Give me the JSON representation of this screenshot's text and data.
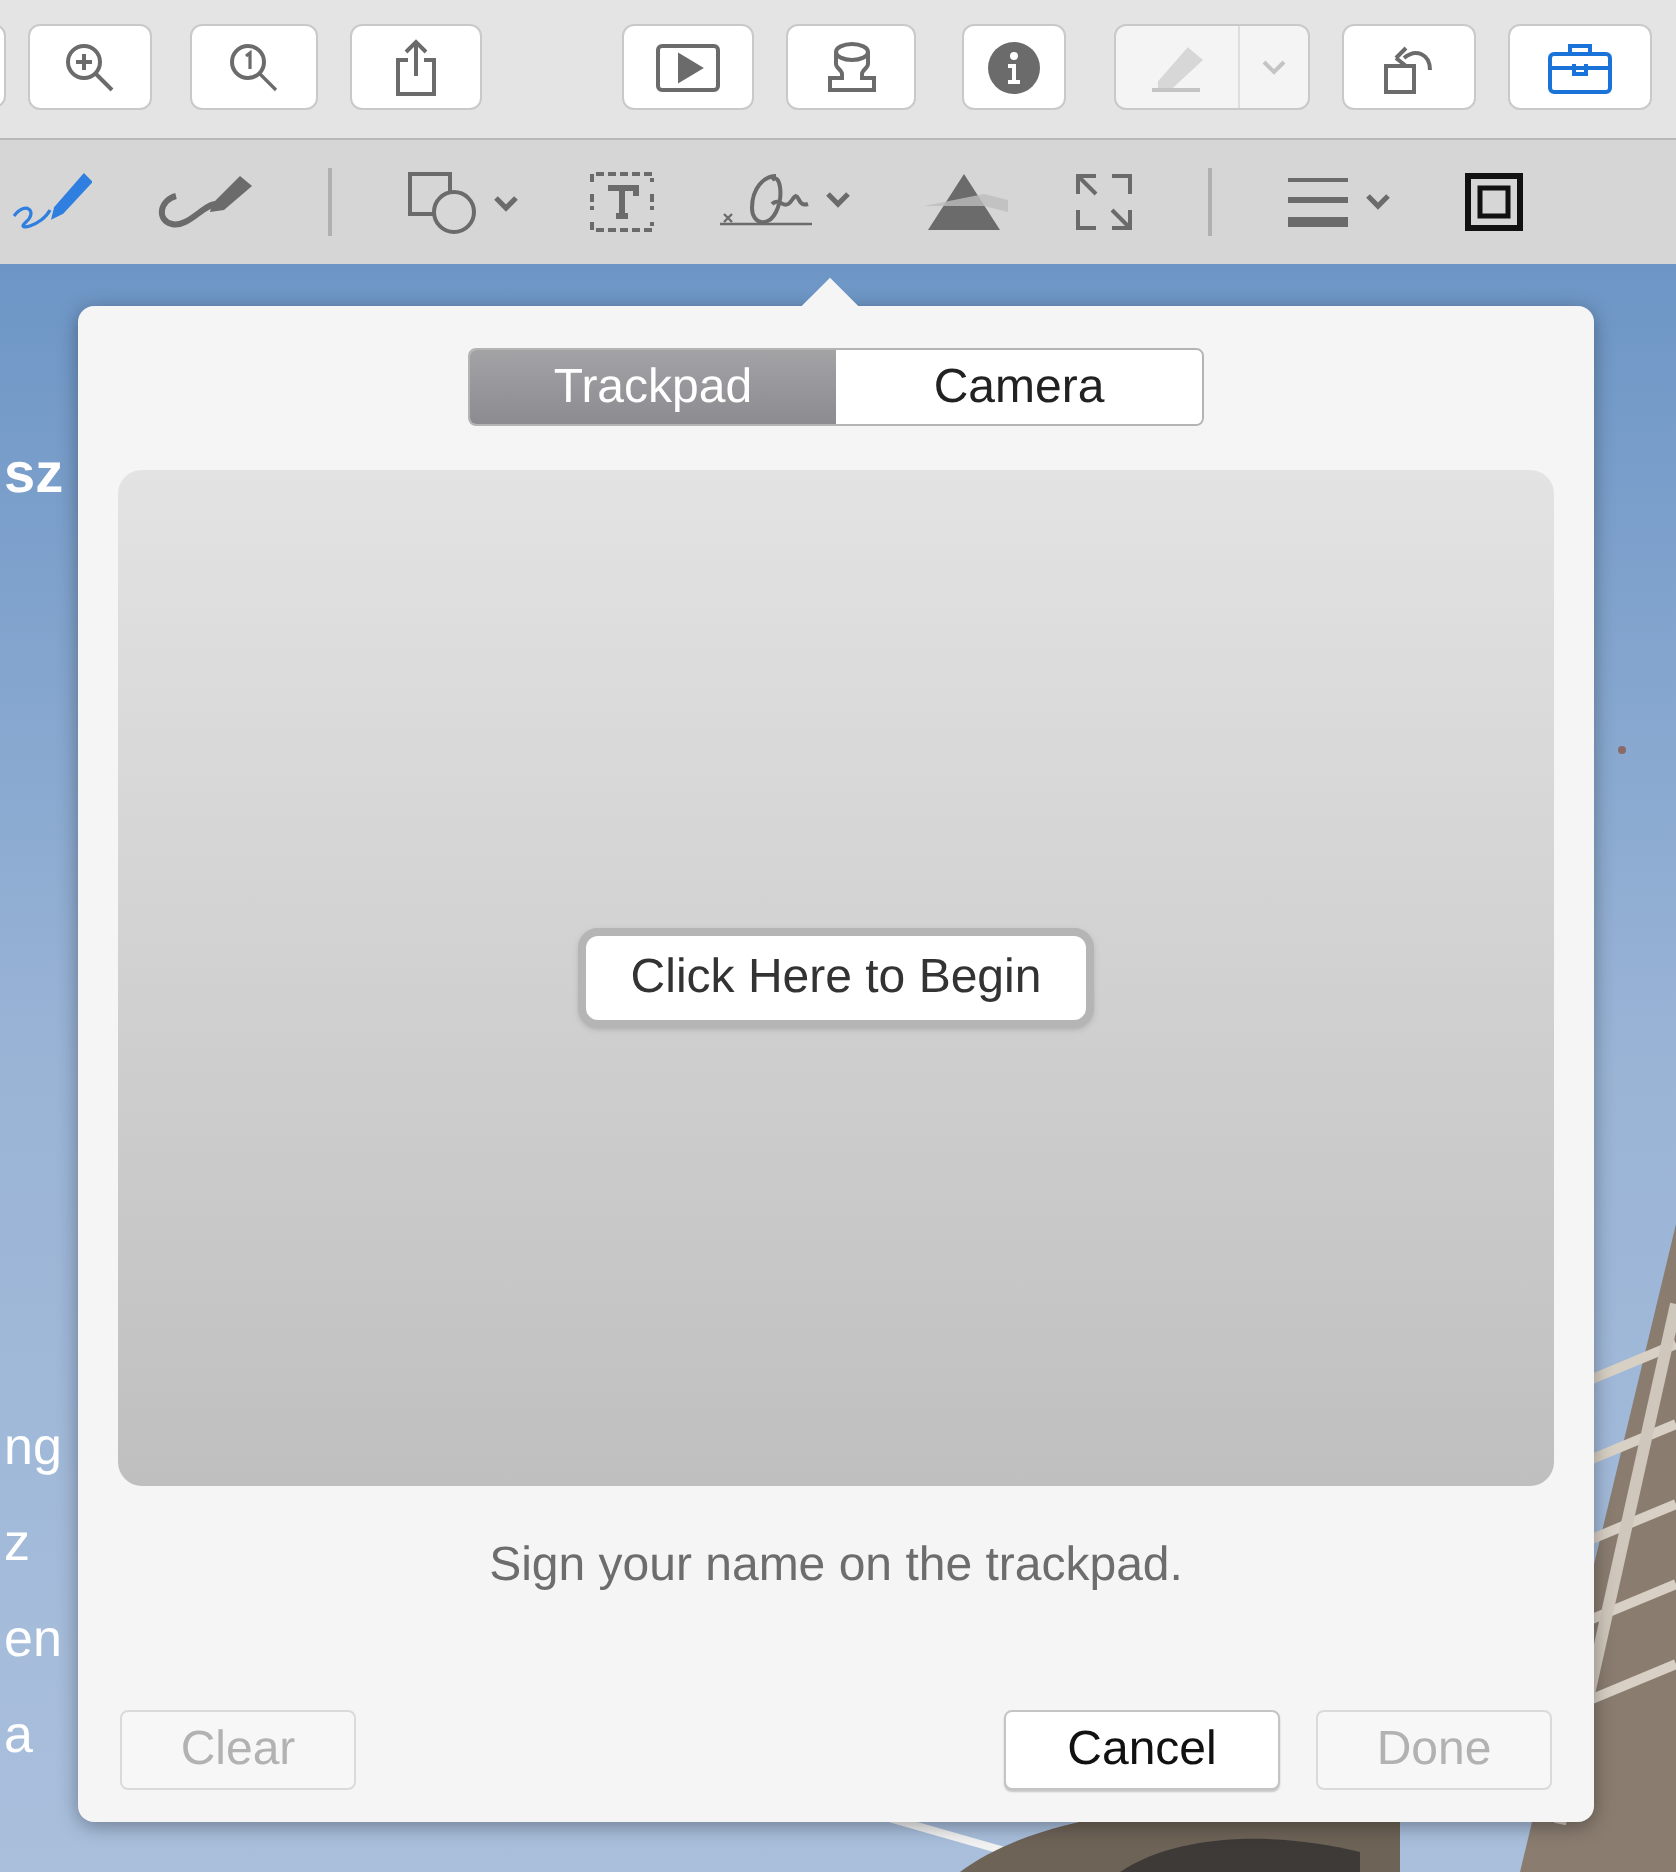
{
  "toolbar": [
    {
      "kind": "zoom-in",
      "disabled": false,
      "selected": false
    },
    {
      "kind": "actual-size",
      "disabled": false,
      "selected": false
    },
    {
      "kind": "share",
      "disabled": false,
      "selected": false
    },
    {
      "kind": "slideshow",
      "disabled": false,
      "selected": false
    },
    {
      "kind": "stamp",
      "disabled": false,
      "selected": false
    },
    {
      "kind": "info",
      "disabled": false,
      "selected": false
    },
    {
      "kind": "highlight",
      "disabled": true,
      "selected": false
    },
    {
      "kind": "rotate",
      "disabled": false,
      "selected": false
    },
    {
      "kind": "toolbox",
      "disabled": false,
      "selected": true
    }
  ],
  "markup_tools": [
    {
      "kind": "sketch",
      "selected": true
    },
    {
      "kind": "draw",
      "selected": false
    },
    {
      "kind": "divider"
    },
    {
      "kind": "shapes",
      "selected": false
    },
    {
      "kind": "text",
      "selected": false
    },
    {
      "kind": "signature",
      "selected": false
    },
    {
      "kind": "adjust-color",
      "selected": false
    },
    {
      "kind": "resize",
      "selected": false
    },
    {
      "kind": "divider"
    },
    {
      "kind": "line-style",
      "selected": false
    },
    {
      "kind": "border",
      "selected": false
    }
  ],
  "document": {
    "kind": "picture",
    "text_fragments": [
      "sz",
      "ng",
      "z",
      "en",
      "a"
    ]
  },
  "signature_popover": {
    "tabs": [
      {
        "label": "Trackpad",
        "selected": true
      },
      {
        "label": "Camera",
        "selected": false
      }
    ],
    "pad_button": "Click Here to Begin",
    "instruction": "Sign your name on the trackpad.",
    "buttons": [
      {
        "label": "Clear",
        "disabled": true
      },
      {
        "label": "Cancel",
        "disabled": false
      },
      {
        "label": "Done",
        "disabled": true
      }
    ]
  }
}
